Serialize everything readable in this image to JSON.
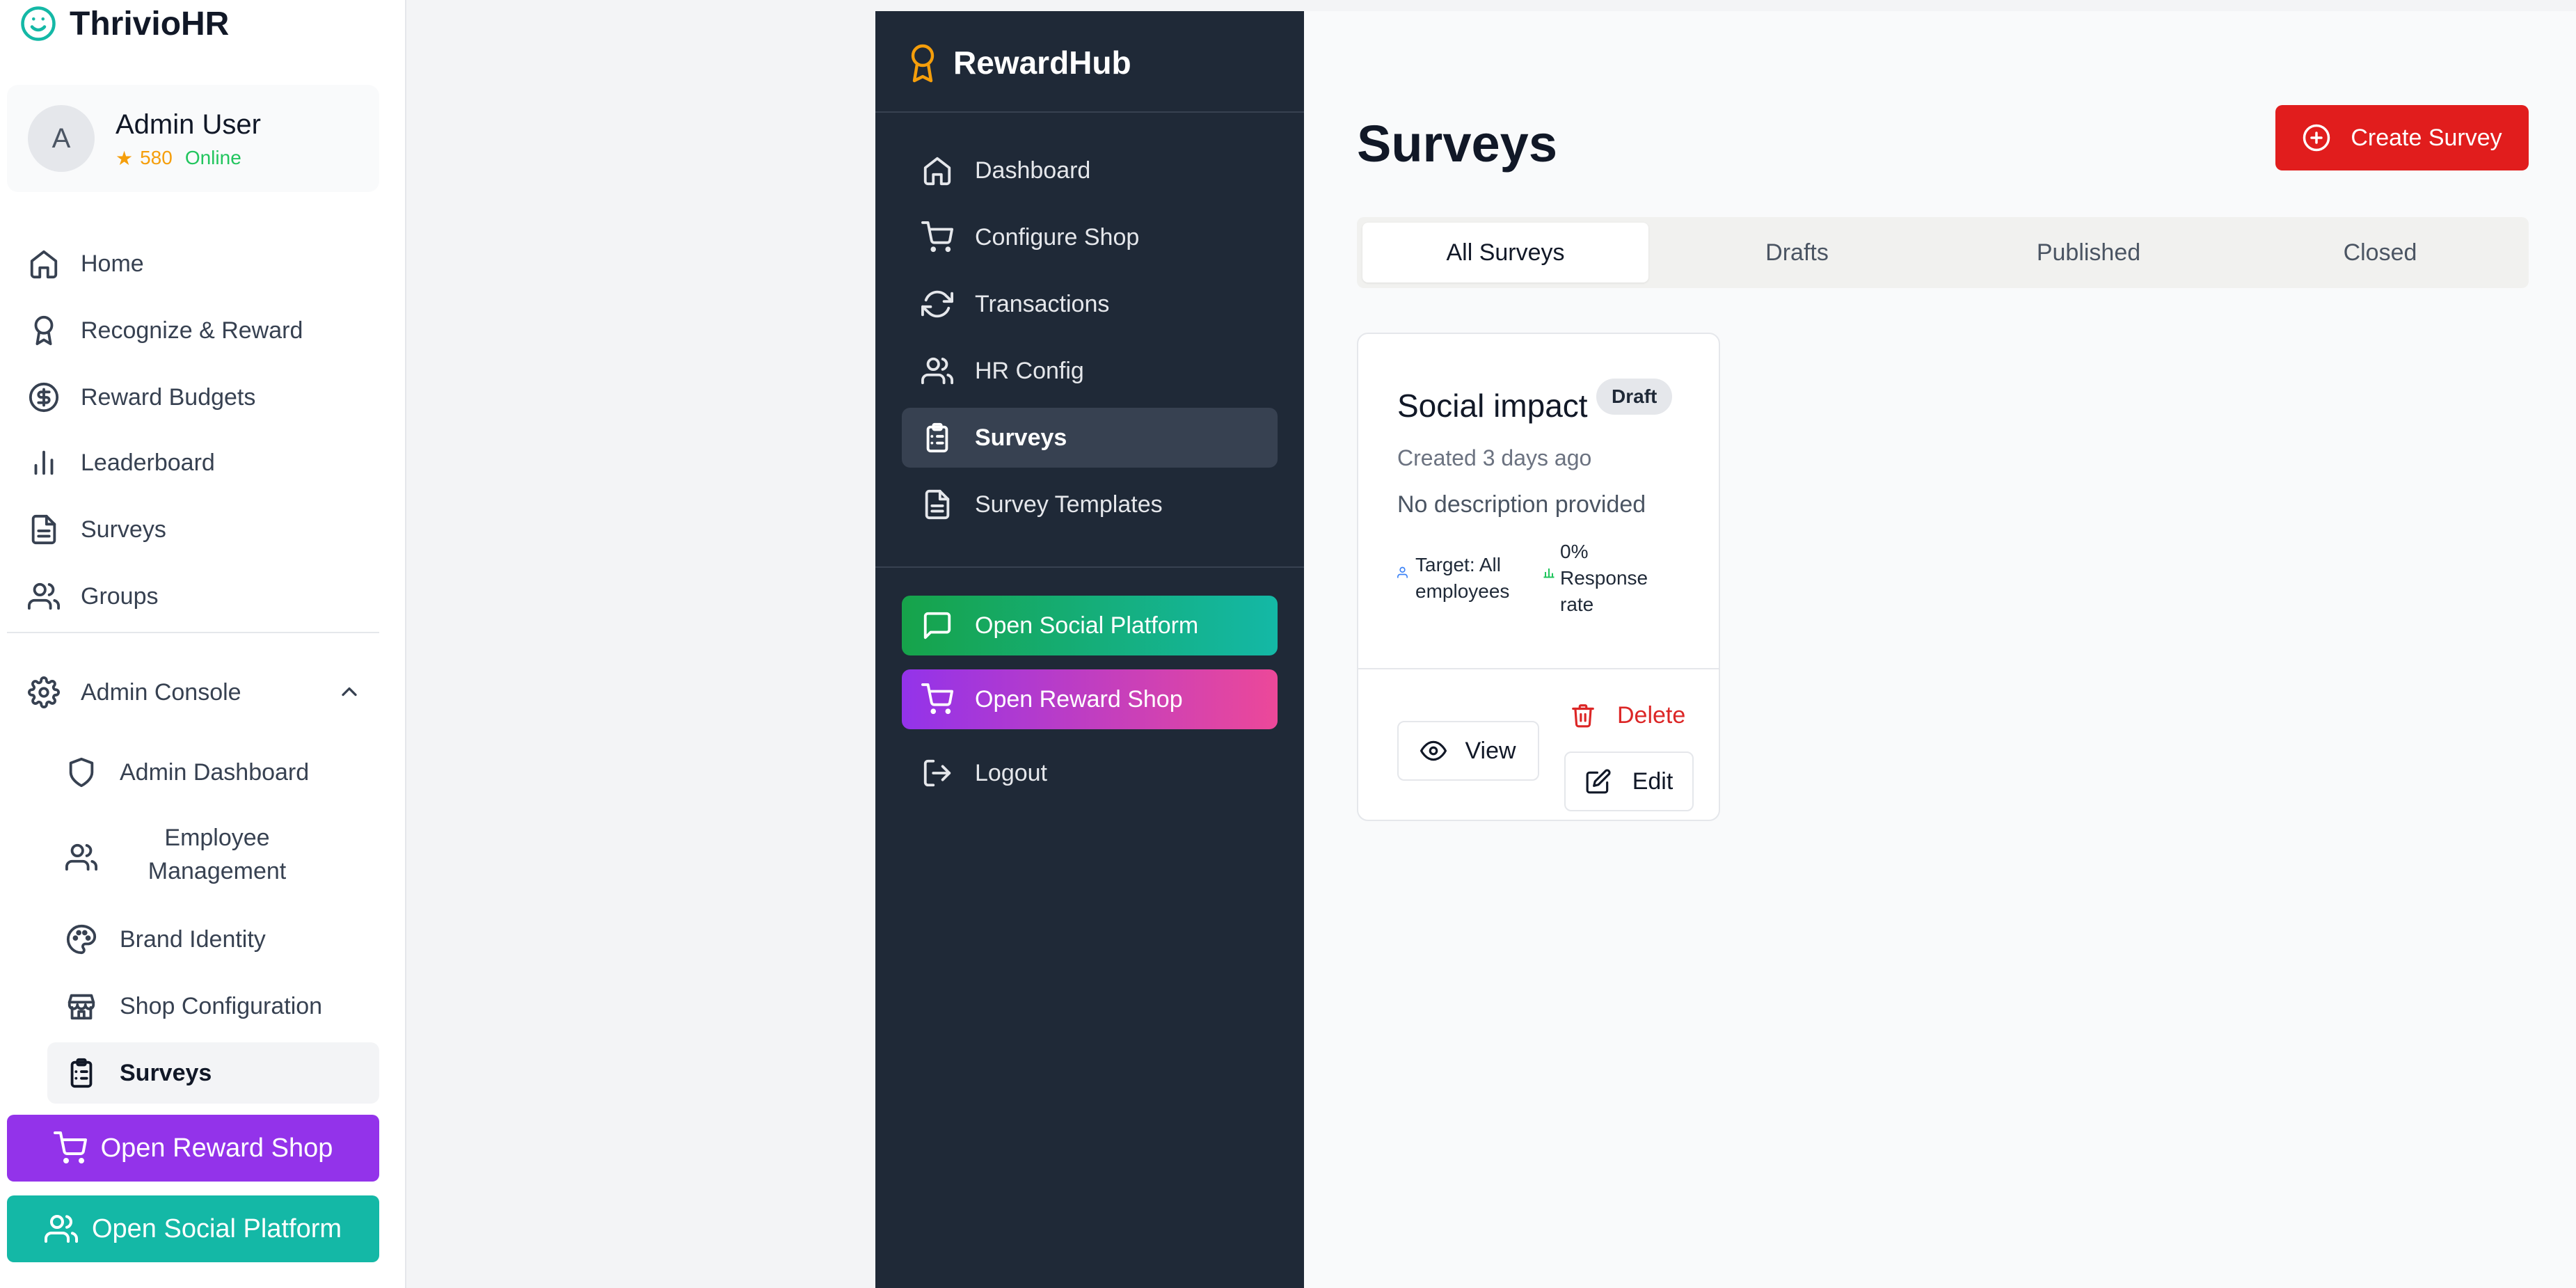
{
  "left_sidebar": {
    "brand": "ThrivioHR",
    "user": {
      "initial": "A",
      "name": "Admin User",
      "points": "580",
      "status": "Online"
    },
    "nav": [
      {
        "label": "Home",
        "icon": "home-icon"
      },
      {
        "label": "Recognize & Reward",
        "icon": "award-icon"
      },
      {
        "label": "Reward Budgets",
        "icon": "dollar-circle-icon"
      },
      {
        "label": "Leaderboard",
        "icon": "bar-chart-icon"
      },
      {
        "label": "Surveys",
        "icon": "file-text-icon"
      },
      {
        "label": "Groups",
        "icon": "users-icon"
      }
    ],
    "admin_console": {
      "label": "Admin Console",
      "items": [
        {
          "label": "Admin Dashboard",
          "icon": "shield-icon"
        },
        {
          "label": "Employee Management",
          "icon": "users-icon"
        },
        {
          "label": "Brand Identity",
          "icon": "palette-icon"
        },
        {
          "label": "Shop Configuration",
          "icon": "store-icon"
        },
        {
          "label": "Surveys",
          "icon": "clipboard-icon",
          "active": true
        }
      ]
    },
    "open_reward_shop": "Open Reward Shop",
    "open_social_platform": "Open Social Platform"
  },
  "dark_sidebar": {
    "brand": "RewardHub",
    "nav": [
      {
        "label": "Dashboard",
        "icon": "home-icon"
      },
      {
        "label": "Configure Shop",
        "icon": "cart-icon"
      },
      {
        "label": "Transactions",
        "icon": "refresh-icon"
      },
      {
        "label": "HR Config",
        "icon": "users-icon"
      },
      {
        "label": "Surveys",
        "icon": "clipboard-icon",
        "active": true
      },
      {
        "label": "Survey Templates",
        "icon": "file-text-icon"
      }
    ],
    "open_social_platform": "Open Social Platform",
    "open_reward_shop": "Open Reward Shop",
    "logout": "Logout"
  },
  "main": {
    "title": "Surveys",
    "create_button": "Create Survey",
    "tabs": [
      {
        "label": "All Surveys",
        "active": true
      },
      {
        "label": "Drafts"
      },
      {
        "label": "Published"
      },
      {
        "label": "Closed"
      }
    ],
    "survey_card": {
      "title": "Social impact",
      "badge": "Draft",
      "created": "Created 3 days ago",
      "description": "No description provided",
      "target": "Target: All employees",
      "response_rate": "0% Response rate",
      "view": "View",
      "delete": "Delete",
      "edit": "Edit"
    }
  },
  "colors": {
    "teal": "#14b8a6",
    "purple": "#9333ea",
    "red": "#e11d1d",
    "dark_sidebar": "#1f2937",
    "amber": "#f59e0b",
    "online": "#22c55e"
  }
}
